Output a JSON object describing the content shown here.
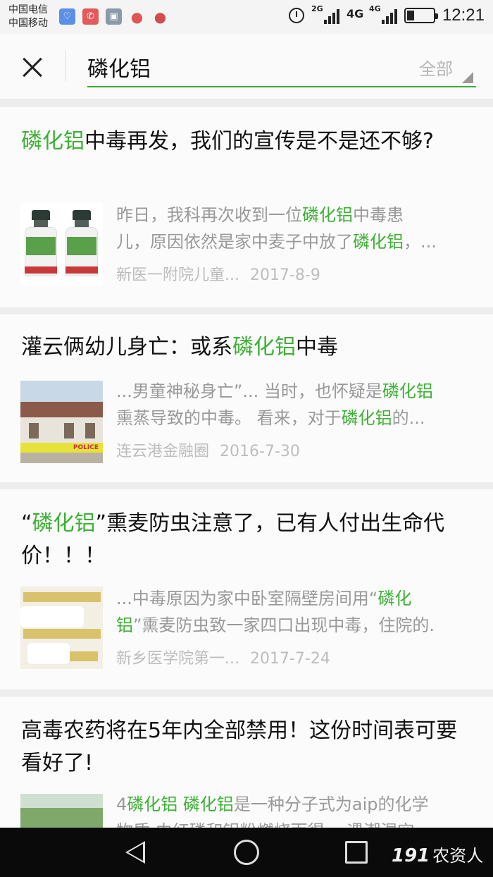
{
  "status": {
    "carrier1": "中国电信",
    "carrier2": "中国移动",
    "sig1_label": "2G",
    "sig2_label": "4G",
    "sig3_label": "4G",
    "time": "12:21"
  },
  "search": {
    "query": "磷化铝",
    "filter": "全部"
  },
  "results": [
    {
      "title_hl": "磷化铝",
      "title_rest": "中毒再发，我们的宣传是不是还不够?",
      "line1_a": "昨日，我科再次收到一位",
      "line1_hl": "磷化铝",
      "line1_b": "中毒患",
      "line2_a": "儿，原因依然是家中麦子中放了",
      "line2_hl": "磷化铝",
      "line2_b": "，...",
      "source": "新医一附院儿童...",
      "date": "2017-8-9"
    },
    {
      "title_a": "灌云俩幼儿身亡：或系",
      "title_hl": "磷化铝",
      "title_b": "中毒",
      "line1_a": "...男童神秘身亡”... 当时，也怀疑是",
      "line1_hl": "磷化铝",
      "line2_a": "熏蒸导致的中毒。 看来，对于",
      "line2_hl": "磷化铝",
      "line2_b": "的...",
      "source": "连云港金融圈",
      "date": "2016-7-30",
      "thumb_text": "POLICE"
    },
    {
      "title_a": "“",
      "title_hl": "磷化铝",
      "title_b": "”熏麦防虫注意了，已有人付出生命代价！！！",
      "line1_a": "...中毒原因为家中卧室隔壁房间用“",
      "line1_hl": "磷化",
      "line2_hl": "铝",
      "line2_b": "”熏麦防虫致一家四口出现中毒，住院的.",
      "source": "新乡医学院第一...",
      "date": "2017-7-24"
    },
    {
      "title": "高毒农药将在5年内全部禁用！这份时间表可要看好了!",
      "line1_a": "4",
      "line1_hl1": "磷化铝",
      "line1_sp": " ",
      "line1_hl2": "磷化铝",
      "line1_b": "是一种分子式为aip的化学",
      "line2_a": "物质,由红磷和铝粉燃烧而得。 遇潮湿空"
    }
  ],
  "watermark": "191",
  "watermark_cn": "农资人",
  "colors": {
    "highlight": "#3cb034",
    "accent_underline": "#3cb034"
  }
}
